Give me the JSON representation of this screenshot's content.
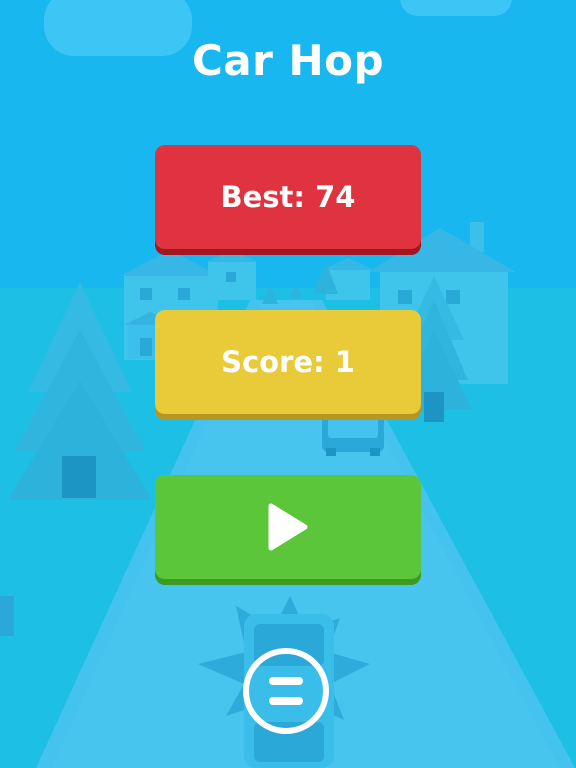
{
  "game": {
    "title": "Car Hop"
  },
  "best": {
    "label": "Best: 74",
    "color": "#e03340"
  },
  "score": {
    "label": "Score: 1",
    "color": "#e9cb3a"
  },
  "play": {
    "icon": "play-icon",
    "color": "#5cc63a"
  },
  "menu": {
    "icon": "menu-icon"
  },
  "colors": {
    "sky": "#19b8ef",
    "ground": "#1ebfe5",
    "road": "#45c3ef"
  }
}
